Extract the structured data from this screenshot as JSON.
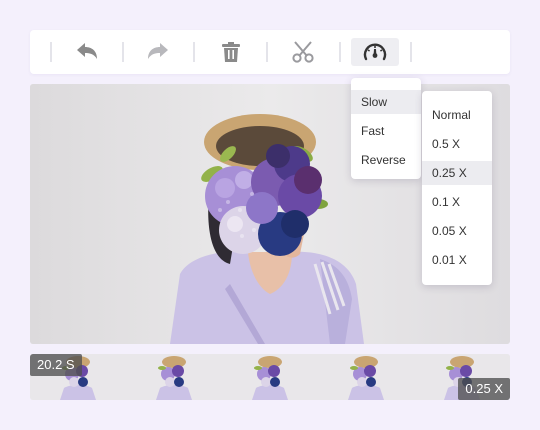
{
  "toolbar": {
    "buttons": [
      {
        "name": "undo",
        "icon": "undo-icon"
      },
      {
        "name": "redo",
        "icon": "redo-icon"
      },
      {
        "name": "delete",
        "icon": "trash-icon"
      },
      {
        "name": "cut",
        "icon": "scissors-icon"
      },
      {
        "name": "speed",
        "icon": "speedometer-icon",
        "active": true
      }
    ]
  },
  "speed_menu": {
    "items": [
      "Slow",
      "Fast",
      "Reverse"
    ],
    "selected": "Slow"
  },
  "speed_submenu": {
    "items": [
      "Normal",
      "0.5 X",
      "0.25 X",
      "0.1 X",
      "0.05 X",
      "0.01 X"
    ],
    "selected": "0.25 X"
  },
  "timeline": {
    "duration_label": "20.2 S",
    "speed_label": "0.25 X"
  },
  "colors": {
    "background": "#f4f0fc",
    "icon": "#8a8a8a",
    "selected_item": "#ececf0"
  }
}
